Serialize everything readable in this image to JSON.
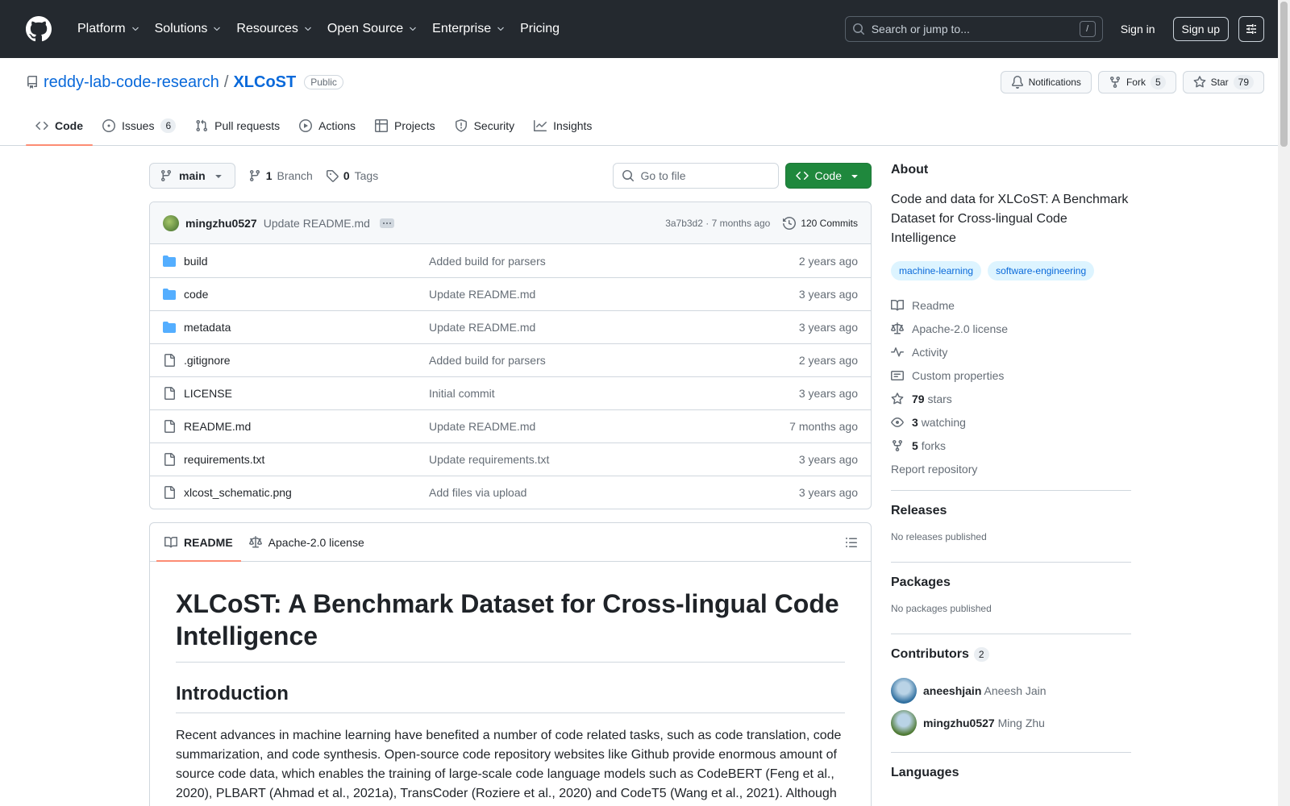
{
  "header": {
    "nav": [
      {
        "label": "Platform",
        "dropdown": true
      },
      {
        "label": "Solutions",
        "dropdown": true
      },
      {
        "label": "Resources",
        "dropdown": true
      },
      {
        "label": "Open Source",
        "dropdown": true
      },
      {
        "label": "Enterprise",
        "dropdown": true
      },
      {
        "label": "Pricing",
        "dropdown": false
      }
    ],
    "search_placeholder": "Search or jump to...",
    "search_shortcut": "/",
    "signin": "Sign in",
    "signup": "Sign up"
  },
  "repo": {
    "owner": "reddy-lab-code-research",
    "separator": "/",
    "name": "XLCoST",
    "visibility": "Public",
    "notifications_label": "Notifications",
    "fork_label": "Fork",
    "fork_count": "5",
    "star_label": "Star",
    "star_count": "79"
  },
  "tabs": [
    {
      "label": "Code",
      "icon": "code-icon",
      "active": true,
      "count": ""
    },
    {
      "label": "Issues",
      "icon": "issue-icon",
      "active": false,
      "count": "6"
    },
    {
      "label": "Pull requests",
      "icon": "pull-request-icon",
      "active": false,
      "count": ""
    },
    {
      "label": "Actions",
      "icon": "play-icon",
      "active": false,
      "count": ""
    },
    {
      "label": "Projects",
      "icon": "table-icon",
      "active": false,
      "count": ""
    },
    {
      "label": "Security",
      "icon": "shield-icon",
      "active": false,
      "count": ""
    },
    {
      "label": "Insights",
      "icon": "graph-icon",
      "active": false,
      "count": ""
    }
  ],
  "toolbar": {
    "branch": "main",
    "branch_count": "1",
    "branch_label": "Branch",
    "tag_count": "0",
    "tag_label": "Tags",
    "goto_placeholder": "Go to file",
    "code_label": "Code"
  },
  "commit": {
    "author": "mingzhu0527",
    "message": "Update README.md",
    "sha": "3a7b3d2",
    "dot": "·",
    "time": "7 months ago",
    "commits_label": "120 Commits"
  },
  "files": [
    {
      "type": "folder",
      "name": "build",
      "message": "Added build for parsers",
      "time": "2 years ago"
    },
    {
      "type": "folder",
      "name": "code",
      "message": "Update README.md",
      "time": "3 years ago"
    },
    {
      "type": "folder",
      "name": "metadata",
      "message": "Update README.md",
      "time": "3 years ago"
    },
    {
      "type": "file",
      "name": ".gitignore",
      "message": "Added build for parsers",
      "time": "2 years ago"
    },
    {
      "type": "file",
      "name": "LICENSE",
      "message": "Initial commit",
      "time": "3 years ago"
    },
    {
      "type": "file",
      "name": "README.md",
      "message": "Update README.md",
      "time": "7 months ago"
    },
    {
      "type": "file",
      "name": "requirements.txt",
      "message": "Update requirements.txt",
      "time": "3 years ago"
    },
    {
      "type": "file",
      "name": "xlcost_schematic.png",
      "message": "Add files via upload",
      "time": "3 years ago"
    }
  ],
  "readme": {
    "tab_readme": "README",
    "tab_license": "Apache-2.0 license",
    "title": "XLCoST: A Benchmark Dataset for Cross-lingual Code Intelligence",
    "intro_heading": "Introduction",
    "intro_text": "Recent advances in machine learning have benefited a number of code related tasks, such as code translation, code summarization, and code synthesis. Open-source code repository websites like Github provide enormous amount of source code data, which enables the training of large-scale code language models such as CodeBERT (Feng et al., 2020), PLBART (Ahmad et al., 2021a), TransCoder (Roziere et al., 2020) and CodeT5 (Wang et al., 2021). Although"
  },
  "about": {
    "heading": "About",
    "description": "Code and data for XLCoST: A Benchmark Dataset for Cross-lingual Code Intelligence",
    "topics": [
      "machine-learning",
      "software-engineering"
    ],
    "links": [
      {
        "icon": "book-icon",
        "count": "",
        "label": "Readme"
      },
      {
        "icon": "law-icon",
        "count": "",
        "label": "Apache-2.0 license"
      },
      {
        "icon": "pulse-icon",
        "count": "",
        "label": "Activity"
      },
      {
        "icon": "note-icon",
        "count": "",
        "label": "Custom properties"
      },
      {
        "icon": "star-icon",
        "count": "79",
        "label": "stars"
      },
      {
        "icon": "eye-icon",
        "count": "3",
        "label": "watching"
      },
      {
        "icon": "fork-icon",
        "count": "5",
        "label": "forks"
      }
    ],
    "report": "Report repository"
  },
  "releases": {
    "heading": "Releases",
    "empty": "No releases published"
  },
  "packages": {
    "heading": "Packages",
    "empty": "No packages published"
  },
  "contributors": {
    "heading": "Contributors",
    "count": "2",
    "people": [
      {
        "login": "aneeshjain",
        "name": "Aneesh Jain",
        "color": "#2f6f9f"
      },
      {
        "login": "mingzhu0527",
        "name": "Ming Zhu",
        "color": "#4f7a34"
      }
    ]
  },
  "languages": {
    "heading": "Languages"
  }
}
